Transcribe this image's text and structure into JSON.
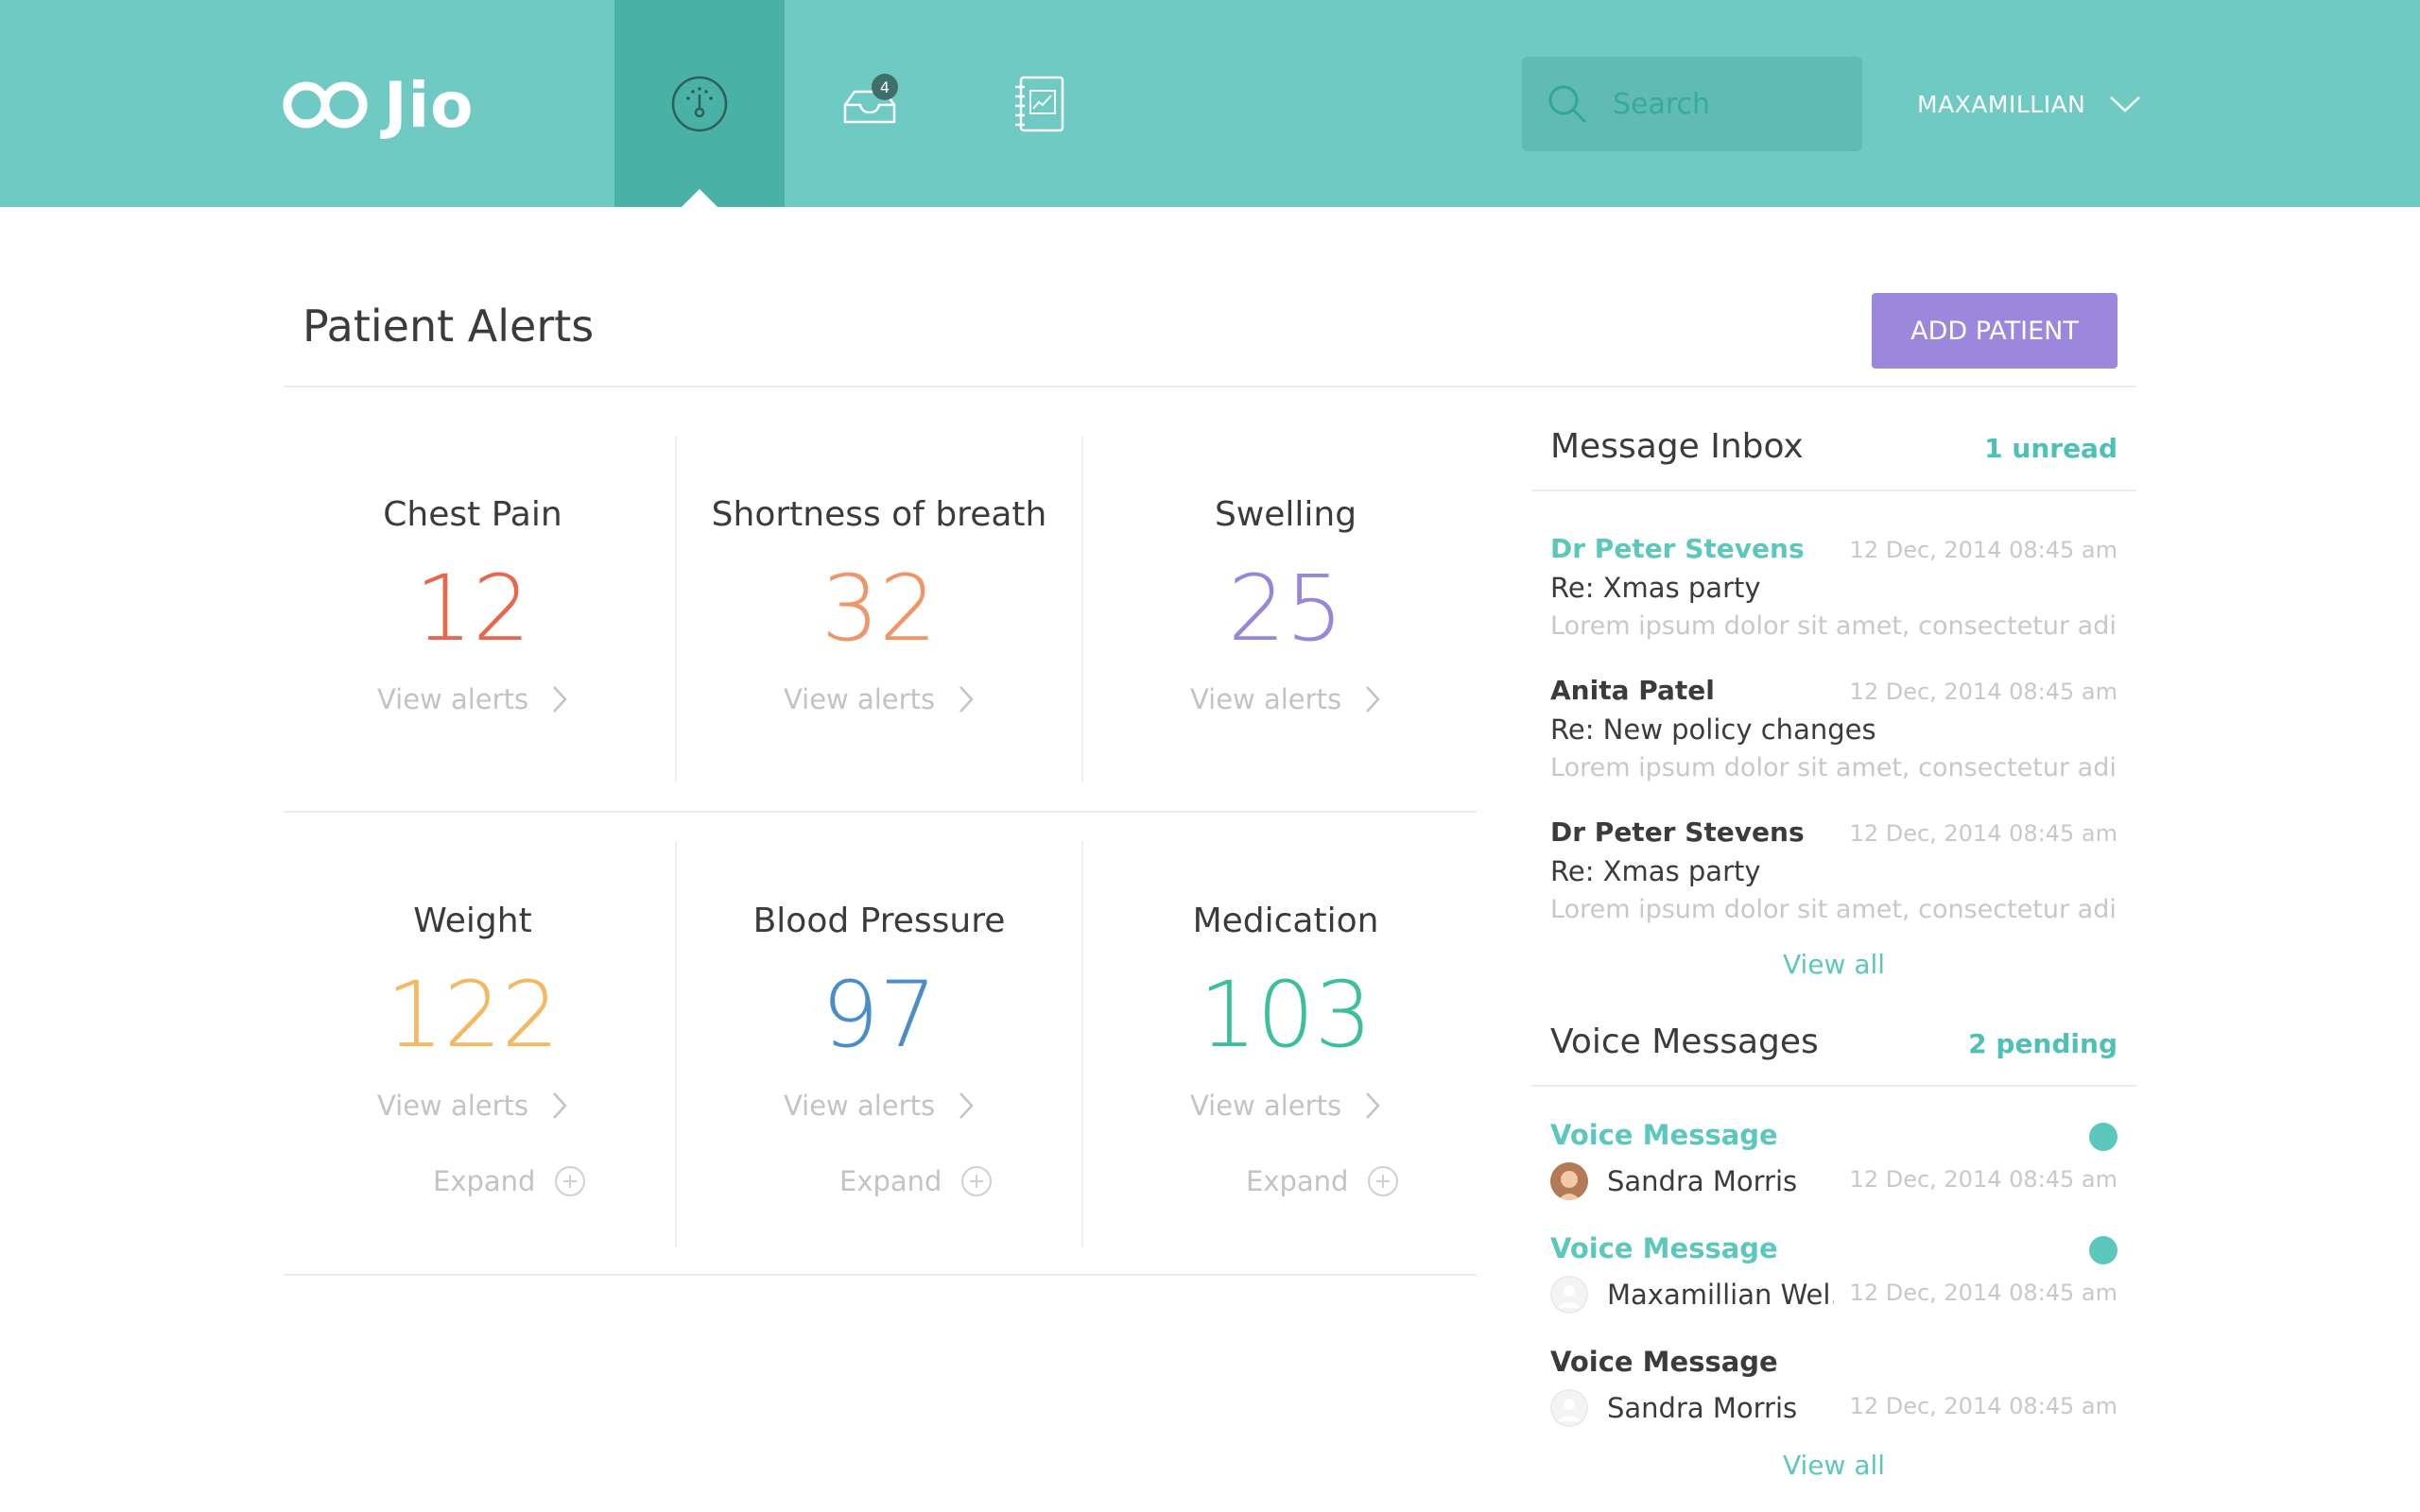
{
  "header": {
    "logo_text": "Jio",
    "nav": [
      {
        "icon": "gauge-icon",
        "active": true
      },
      {
        "icon": "inbox-tray-icon",
        "badge": "4"
      },
      {
        "icon": "report-book-icon"
      }
    ],
    "search_placeholder": "Search",
    "user_name": "MAXAMILLIAN"
  },
  "page": {
    "title": "Patient Alerts",
    "add_button": "ADD PATIENT"
  },
  "alerts": [
    {
      "title": "Chest Pain",
      "count": "12",
      "color": "#e8674c",
      "link": "View alerts"
    },
    {
      "title": "Shortness of breath",
      "count": "32",
      "color": "#f0946a",
      "link": "View alerts"
    },
    {
      "title": "Swelling",
      "count": "25",
      "color": "#9a86d8",
      "link": "View alerts"
    },
    {
      "title": "Weight",
      "count": "122",
      "color": "#f4b860",
      "link": "View alerts",
      "expand": "Expand"
    },
    {
      "title": "Blood Pressure",
      "count": "97",
      "color": "#4a8ec8",
      "link": "View alerts",
      "expand": "Expand"
    },
    {
      "title": "Medication",
      "count": "103",
      "color": "#3cbf9e",
      "link": "View alerts",
      "expand": "Expand"
    }
  ],
  "inbox": {
    "title": "Message Inbox",
    "count": "1 unread",
    "messages": [
      {
        "sender": "Dr Peter Stevens",
        "date": "12 Dec, 2014 08:45 am",
        "subject": "Re: Xmas party",
        "preview": "Lorem ipsum dolor sit amet, consectetur adipi...",
        "unread": true
      },
      {
        "sender": "Anita Patel",
        "date": "12 Dec, 2014 08:45 am",
        "subject": "Re: New policy changes",
        "preview": "Lorem ipsum dolor sit amet, consectetur adipi...",
        "unread": false
      },
      {
        "sender": "Dr Peter Stevens",
        "date": "12 Dec, 2014 08:45 am",
        "subject": "Re: Xmas party",
        "preview": "Lorem ipsum dolor sit amet, consectetur adipi...",
        "unread": false
      }
    ],
    "view_all": "View all"
  },
  "voice": {
    "title": "Voice Messages",
    "count": "2 pending",
    "items": [
      {
        "title": "Voice Message",
        "name": "Sandra Morris",
        "date": "12 Dec, 2014 08:45 am",
        "unread": true,
        "avatar": "photo"
      },
      {
        "title": "Voice Message",
        "name": "Maxamillian Wel...",
        "date": "12 Dec, 2014 08:45 am",
        "unread": true,
        "avatar": "placeholder"
      },
      {
        "title": "Voice Message",
        "name": "Sandra Morris",
        "date": "12 Dec, 2014 08:45 am",
        "unread": false,
        "avatar": "placeholder"
      }
    ],
    "view_all": "View all"
  },
  "colors": {
    "header": "#6ecac2",
    "header_active": "#49b1a6",
    "accent": "#5cc7bc",
    "button": "#9b87dc"
  }
}
